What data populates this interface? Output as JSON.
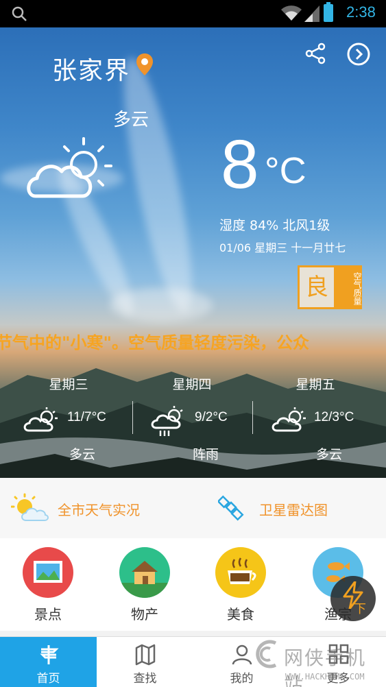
{
  "status_bar": {
    "time": "2:38"
  },
  "hero": {
    "city": "张家界",
    "condition_now": "多云",
    "temperature": "8",
    "temp_unit": "°C",
    "humidity_wind": "湿度  84%  北风1级",
    "date_line": "01/06 星期三 十一月廿七",
    "aqi_grade": "良",
    "aqi_label": "空气质量",
    "ticker": "节气中的\"小寒\"。空气质量轻度污染，公众"
  },
  "forecast": [
    {
      "day": "星期三",
      "range": "11/7°C",
      "desc": "多云",
      "icon": "partly-cloudy-icon"
    },
    {
      "day": "星期四",
      "range": "9/2°C",
      "desc": "阵雨",
      "icon": "shower-icon"
    },
    {
      "day": "星期五",
      "range": "12/3°C",
      "desc": "多云",
      "icon": "partly-cloudy-icon"
    }
  ],
  "quick_links": [
    {
      "label": "全市天气实况",
      "icon": "sun-cloud-icon"
    },
    {
      "label": "卫星雷达图",
      "icon": "satellite-icon"
    }
  ],
  "categories": [
    {
      "label": "景点",
      "color": "#e84a4a"
    },
    {
      "label": "物产",
      "color": "#2dbf8a"
    },
    {
      "label": "美食",
      "color": "#f5c518"
    },
    {
      "label": "渔宗",
      "color": "#5bbde8"
    }
  ],
  "fab_label": "下",
  "nav": [
    {
      "label": "首页",
      "active": true
    },
    {
      "label": "查找",
      "active": false
    },
    {
      "label": "我的",
      "active": false
    },
    {
      "label": "更多",
      "active": false
    }
  ],
  "watermark": {
    "text": "网侠手机站",
    "url": "WWW.HACKHOME.COM"
  },
  "colors": {
    "accent": "#1fa3e6",
    "orange": "#f0932b",
    "aqi": "#f0a020"
  }
}
